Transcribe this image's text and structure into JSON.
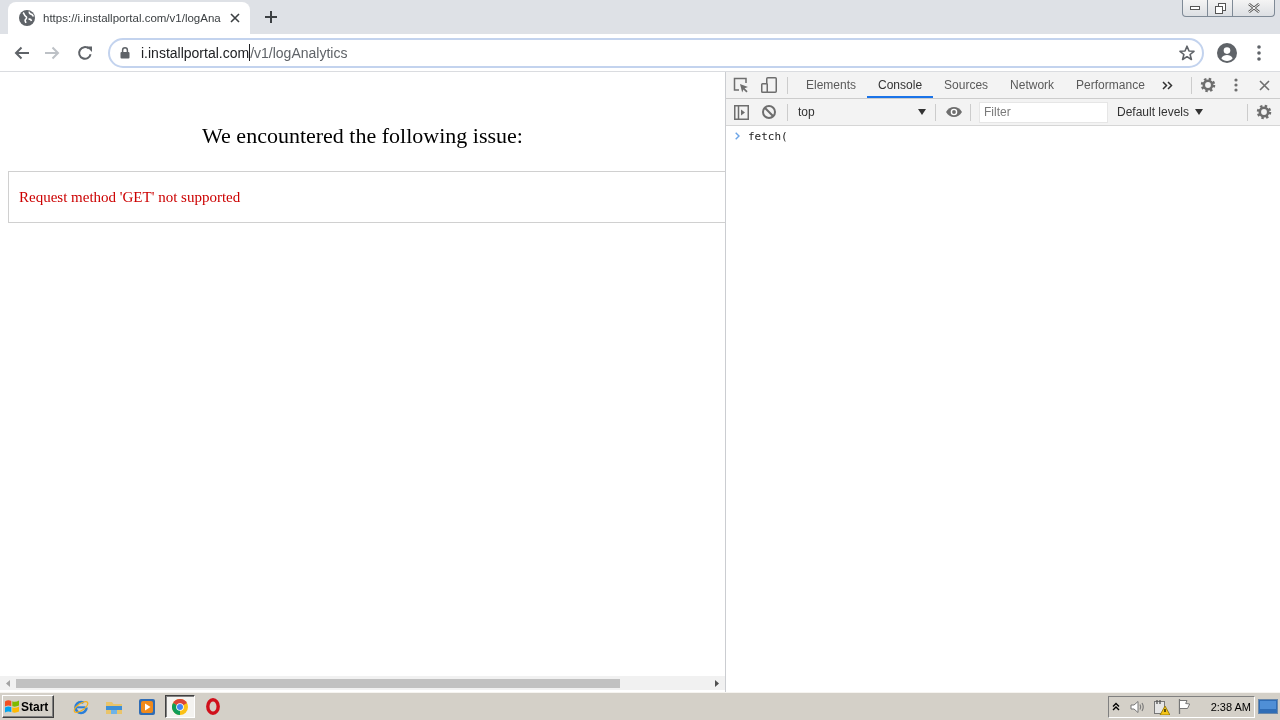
{
  "browser": {
    "tabs": [
      {
        "title": "https://i.installportal.com/v1/logAna",
        "selected": true
      }
    ],
    "nav_buttons": [
      {
        "kind": "back",
        "disabled": false
      },
      {
        "kind": "forward",
        "disabled": true
      },
      {
        "kind": "reload",
        "disabled": false
      }
    ],
    "address_bar": {
      "host": "i.installportal.com",
      "path": "/v1/logAnalytics",
      "focused": true
    }
  },
  "page": {
    "heading": "We encountered the following issue:",
    "error_message": "Request method 'GET' not supported"
  },
  "devtools": {
    "tabs": [
      {
        "label": "Elements",
        "selected": false
      },
      {
        "label": "Console",
        "selected": true
      },
      {
        "label": "Sources",
        "selected": false
      },
      {
        "label": "Network",
        "selected": false
      },
      {
        "label": "Performance",
        "selected": false
      }
    ],
    "context": "top",
    "filter": {
      "placeholder": "Filter"
    },
    "log_levels": "Default levels",
    "console_lines": [
      {
        "kind": "input",
        "text": "fetch("
      }
    ]
  },
  "taskbar": {
    "start_label": "Start",
    "apps": [
      {
        "kind": "ie",
        "selected": false
      },
      {
        "kind": "folder",
        "selected": false
      },
      {
        "kind": "player",
        "selected": false
      },
      {
        "kind": "chrome",
        "selected": true
      },
      {
        "kind": "opera",
        "selected": false
      }
    ],
    "clock": "2:38 AM"
  }
}
